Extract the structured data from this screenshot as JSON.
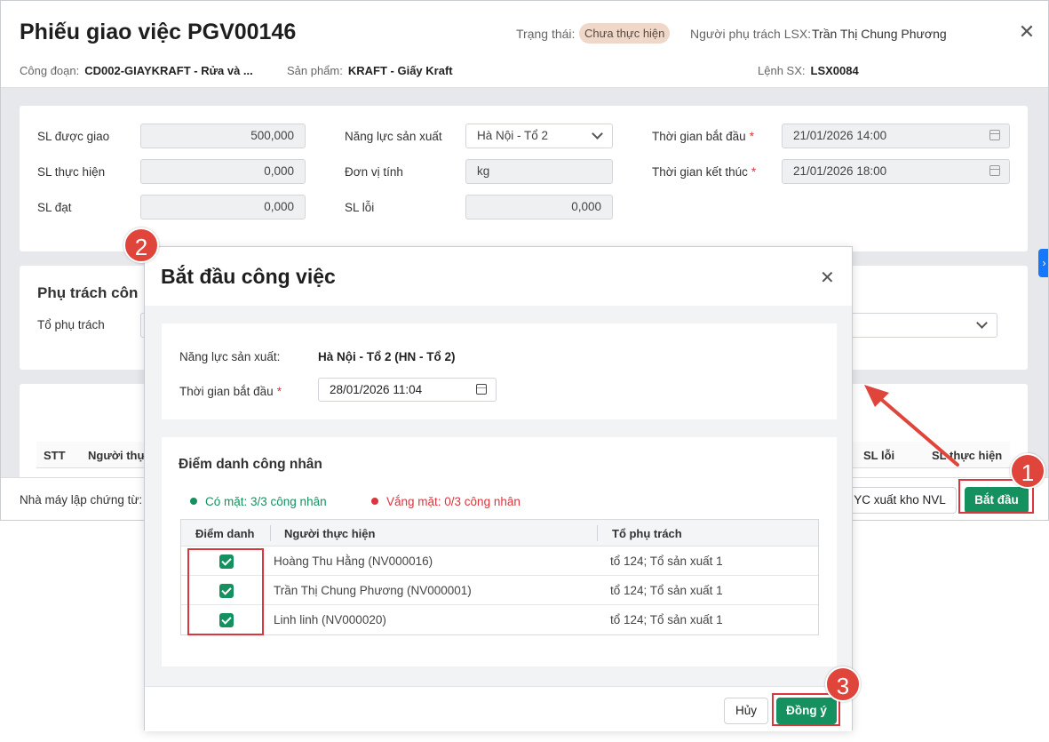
{
  "window": {
    "title": "Phiếu giao việc PGV00146",
    "status_label": "Trạng thái:",
    "status_value": "Chưa thực hiện",
    "owner_label": "Người phụ trách LSX:",
    "owner_value": "Trần Thị Chung Phương",
    "stage_label": "Công đoạn:",
    "stage_value": "CD002-GIAYKRAFT - Rửa và ...",
    "product_label": "Sản phẩm:",
    "product_value": "KRAFT - Giấy Kraft",
    "order_label": "Lệnh SX:",
    "order_value": "LSX0084"
  },
  "form": {
    "qty_assigned_label": "SL được giao",
    "qty_assigned_value": "500,000",
    "qty_done_label": "SL thực hiện",
    "qty_done_value": "0,000",
    "qty_ok_label": "SL đạt",
    "qty_ok_value": "0,000",
    "capacity_label": "Năng lực sản xuất",
    "capacity_value": "Hà Nội - Tổ 2",
    "unit_label": "Đơn vị tính",
    "unit_value": "kg",
    "qty_error_label": "SL lỗi",
    "qty_error_value": "0,000",
    "start_label": "Thời gian bắt đầu",
    "start_value": "21/01/2026 14:00",
    "end_label": "Thời gian kết thúc",
    "end_value": "21/01/2026 18:00"
  },
  "responsible": {
    "section_title": "Phụ trách côn",
    "group_label": "Tổ phụ trách"
  },
  "table": {
    "headers": [
      "STT",
      "Người thực",
      "SL lỗi",
      "SL thực hiện"
    ]
  },
  "footer": {
    "factory_label": "Nhà máy lập chứng từ:",
    "yc_button": "YC xuất kho NVL",
    "start_button": "Bắt đầu"
  },
  "modal": {
    "title": "Bắt đầu công việc",
    "capacity_label": "Năng lực sản xuất:",
    "capacity_value": "Hà Nội - Tổ 2 (HN - Tổ 2)",
    "start_label": "Thời gian bắt đầu",
    "start_value": "28/01/2026 11:04",
    "attendance_title": "Điểm danh công nhân",
    "present_text": "Có mặt: 3/3 công nhân",
    "absent_text": "Vắng mặt: 0/3 công nhân",
    "col_attendance": "Điểm danh",
    "col_worker": "Người thực hiện",
    "col_group": "Tổ phụ trách",
    "rows": [
      {
        "worker": "Hoàng Thu Hằng (NV000016)",
        "group": "tổ 124; Tổ sản xuất 1"
      },
      {
        "worker": "Trần Thị Chung Phương (NV000001)",
        "group": "tổ 124; Tổ sản xuất 1"
      },
      {
        "worker": "Linh linh (NV000020)",
        "group": "tổ 124; Tổ sản xuất 1"
      }
    ],
    "cancel_button": "Hủy",
    "ok_button": "Đồng ý"
  },
  "steps": [
    "1",
    "2",
    "3"
  ],
  "colors": {
    "accent_green": "#14915f",
    "annotation_red": "#d9363e",
    "status_badge_bg": "#efd7c9"
  }
}
